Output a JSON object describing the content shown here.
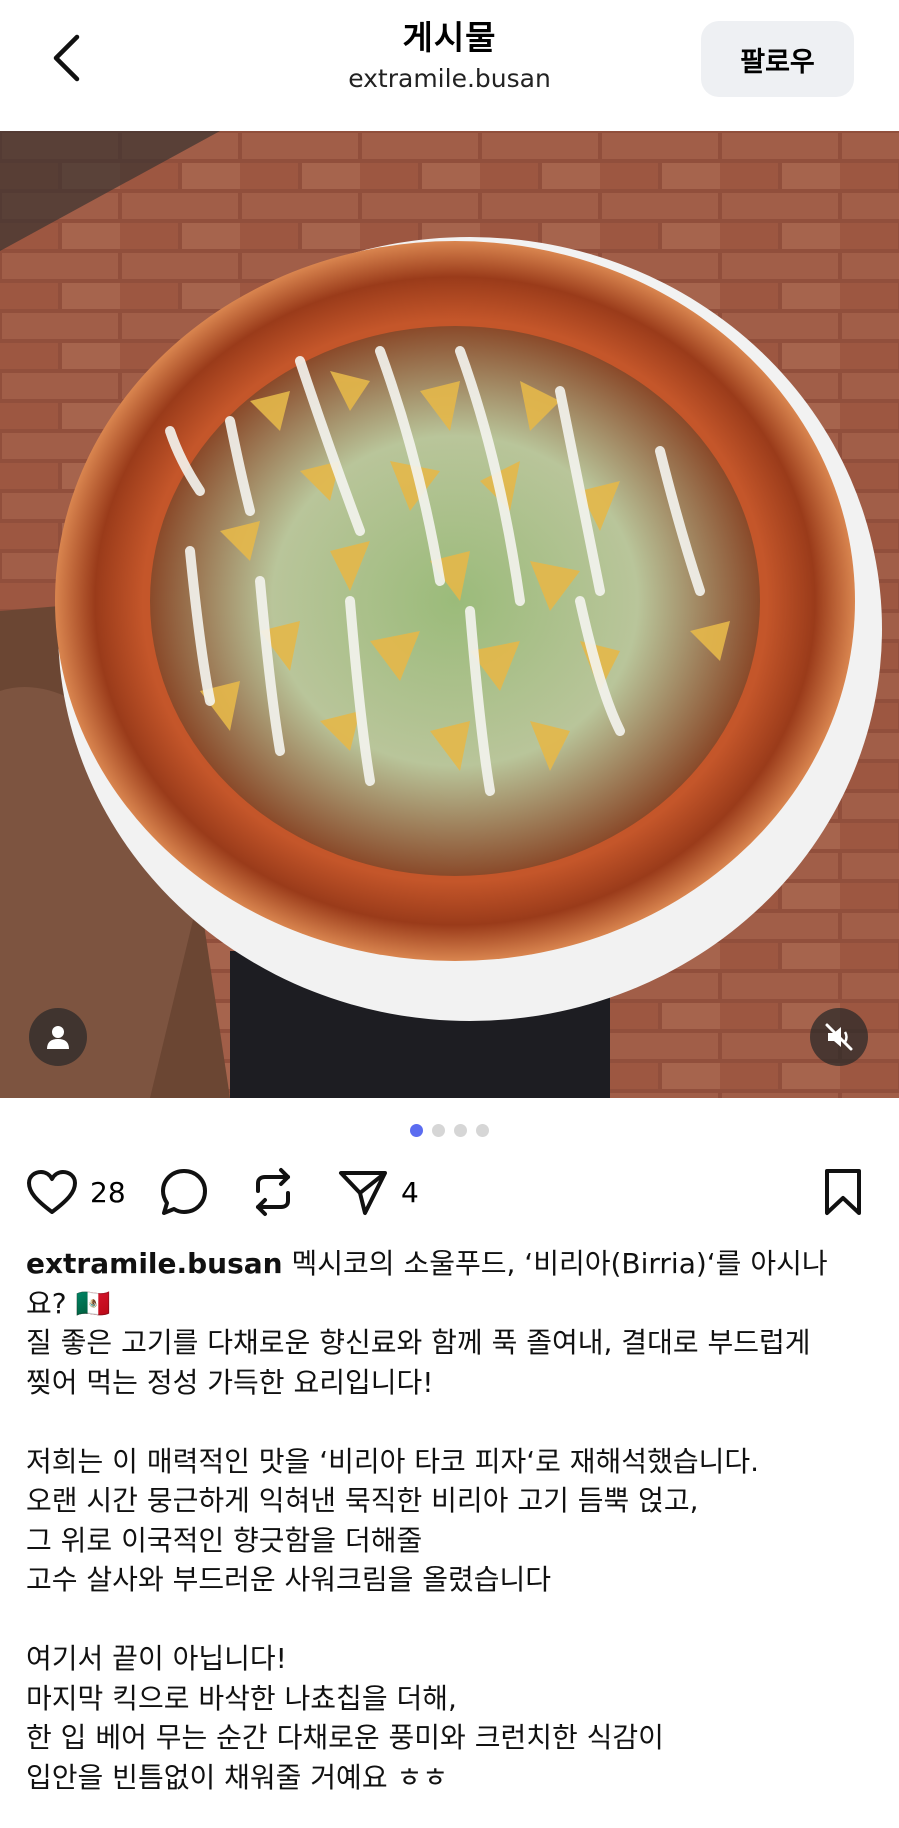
{
  "header": {
    "title": "게시물",
    "subtitle": "extramile.busan",
    "follow_label": "팔로우"
  },
  "icons": {
    "back": "chevron-left-icon",
    "user_tag": "user-tag-icon",
    "mute": "speaker-muted-icon",
    "like": "heart-icon",
    "comment": "comment-bubble-icon",
    "repost": "repost-icon",
    "share": "send-icon",
    "bookmark": "bookmark-icon"
  },
  "carousel": {
    "count": 4,
    "active_index": 0,
    "active_color": "#5b6cf0"
  },
  "actions": {
    "like_count": "28",
    "share_count": "4"
  },
  "caption": {
    "username": "extramile.busan",
    "line1": "멕시코의 소울푸드, ‘비리아(Birria)‘를 아시나",
    "line2": "요? 🇲🇽",
    "lines": [
      "질 좋은 고기를 다채로운 향신료와 함께 푹 졸여내, 결대로 부드럽게",
      "찢어 먹는 정성 가득한 요리입니다!",
      "",
      "저희는 이 매력적인 맛을 ‘비리아 타코 피자‘로 재해석했습니다.",
      "오랜 시간 뭉근하게 익혀낸 묵직한 비리아 고기 듬뿍 얹고,",
      "그 위로 이국적인 향긋함을 더해줄",
      "고수 살사와 부드러운 사워크림을 올렸습니다",
      "",
      "여기서 끝이 아닙니다!",
      "마지막 킥으로 바삭한 나쵸칩을 더해,",
      "한 입 베어 무는 순간 다채로운 풍미와 크런치한 식감이",
      "입안을 빈틈없이 채워줄 거예요 ㅎㅎ"
    ]
  }
}
